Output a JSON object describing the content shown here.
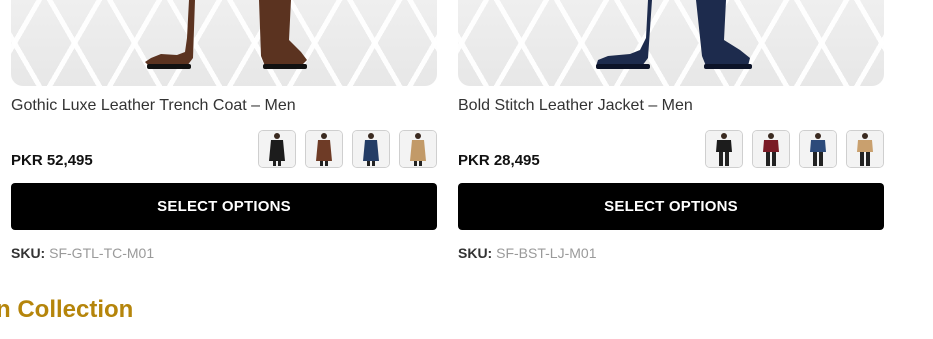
{
  "products": [
    {
      "title": "Gothic Luxe Leather Trench Coat – Men",
      "price": "PKR 52,495",
      "button_label": "SELECT OPTIONS",
      "sku_label": "SKU:",
      "sku_value": "SF-GTL-TC-M01",
      "boot_color": "#5b3320",
      "swatches": [
        {
          "name": "black-coat",
          "color": "#1c1c1c"
        },
        {
          "name": "brown-coat",
          "color": "#6e3b26"
        },
        {
          "name": "navy-coat",
          "color": "#243d66"
        },
        {
          "name": "tan-coat",
          "color": "#c29a68"
        }
      ]
    },
    {
      "title": "Bold Stitch Leather Jacket – Men",
      "price": "PKR 28,495",
      "button_label": "SELECT OPTIONS",
      "sku_label": "SKU:",
      "sku_value": "SF-BST-LJ-M01",
      "boot_color": "#1d2b4d",
      "swatches": [
        {
          "name": "black-jacket",
          "color": "#1c1c1c"
        },
        {
          "name": "maroon-jacket",
          "color": "#7a1b26"
        },
        {
          "name": "navy-jacket",
          "color": "#2c4a7a"
        },
        {
          "name": "tan-jacket",
          "color": "#c9a06e"
        }
      ]
    }
  ],
  "section_heading": "n Collection",
  "accent_color": "#b5850b"
}
